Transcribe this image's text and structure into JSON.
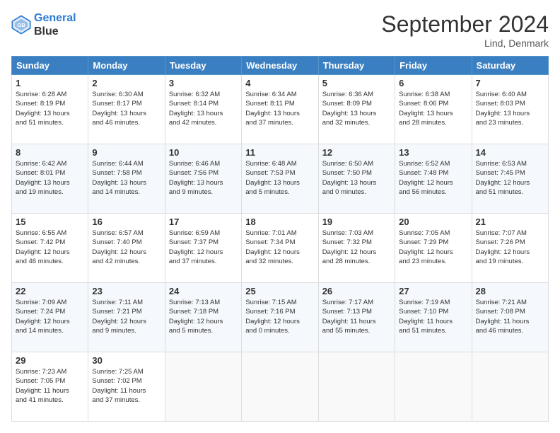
{
  "header": {
    "logo_line1": "General",
    "logo_line2": "Blue",
    "month_title": "September 2024",
    "location": "Lind, Denmark"
  },
  "days_of_week": [
    "Sunday",
    "Monday",
    "Tuesday",
    "Wednesday",
    "Thursday",
    "Friday",
    "Saturday"
  ],
  "weeks": [
    [
      {
        "day": "1",
        "info": "Sunrise: 6:28 AM\nSunset: 8:19 PM\nDaylight: 13 hours\nand 51 minutes."
      },
      {
        "day": "2",
        "info": "Sunrise: 6:30 AM\nSunset: 8:17 PM\nDaylight: 13 hours\nand 46 minutes."
      },
      {
        "day": "3",
        "info": "Sunrise: 6:32 AM\nSunset: 8:14 PM\nDaylight: 13 hours\nand 42 minutes."
      },
      {
        "day": "4",
        "info": "Sunrise: 6:34 AM\nSunset: 8:11 PM\nDaylight: 13 hours\nand 37 minutes."
      },
      {
        "day": "5",
        "info": "Sunrise: 6:36 AM\nSunset: 8:09 PM\nDaylight: 13 hours\nand 32 minutes."
      },
      {
        "day": "6",
        "info": "Sunrise: 6:38 AM\nSunset: 8:06 PM\nDaylight: 13 hours\nand 28 minutes."
      },
      {
        "day": "7",
        "info": "Sunrise: 6:40 AM\nSunset: 8:03 PM\nDaylight: 13 hours\nand 23 minutes."
      }
    ],
    [
      {
        "day": "8",
        "info": "Sunrise: 6:42 AM\nSunset: 8:01 PM\nDaylight: 13 hours\nand 19 minutes."
      },
      {
        "day": "9",
        "info": "Sunrise: 6:44 AM\nSunset: 7:58 PM\nDaylight: 13 hours\nand 14 minutes."
      },
      {
        "day": "10",
        "info": "Sunrise: 6:46 AM\nSunset: 7:56 PM\nDaylight: 13 hours\nand 9 minutes."
      },
      {
        "day": "11",
        "info": "Sunrise: 6:48 AM\nSunset: 7:53 PM\nDaylight: 13 hours\nand 5 minutes."
      },
      {
        "day": "12",
        "info": "Sunrise: 6:50 AM\nSunset: 7:50 PM\nDaylight: 13 hours\nand 0 minutes."
      },
      {
        "day": "13",
        "info": "Sunrise: 6:52 AM\nSunset: 7:48 PM\nDaylight: 12 hours\nand 56 minutes."
      },
      {
        "day": "14",
        "info": "Sunrise: 6:53 AM\nSunset: 7:45 PM\nDaylight: 12 hours\nand 51 minutes."
      }
    ],
    [
      {
        "day": "15",
        "info": "Sunrise: 6:55 AM\nSunset: 7:42 PM\nDaylight: 12 hours\nand 46 minutes."
      },
      {
        "day": "16",
        "info": "Sunrise: 6:57 AM\nSunset: 7:40 PM\nDaylight: 12 hours\nand 42 minutes."
      },
      {
        "day": "17",
        "info": "Sunrise: 6:59 AM\nSunset: 7:37 PM\nDaylight: 12 hours\nand 37 minutes."
      },
      {
        "day": "18",
        "info": "Sunrise: 7:01 AM\nSunset: 7:34 PM\nDaylight: 12 hours\nand 32 minutes."
      },
      {
        "day": "19",
        "info": "Sunrise: 7:03 AM\nSunset: 7:32 PM\nDaylight: 12 hours\nand 28 minutes."
      },
      {
        "day": "20",
        "info": "Sunrise: 7:05 AM\nSunset: 7:29 PM\nDaylight: 12 hours\nand 23 minutes."
      },
      {
        "day": "21",
        "info": "Sunrise: 7:07 AM\nSunset: 7:26 PM\nDaylight: 12 hours\nand 19 minutes."
      }
    ],
    [
      {
        "day": "22",
        "info": "Sunrise: 7:09 AM\nSunset: 7:24 PM\nDaylight: 12 hours\nand 14 minutes."
      },
      {
        "day": "23",
        "info": "Sunrise: 7:11 AM\nSunset: 7:21 PM\nDaylight: 12 hours\nand 9 minutes."
      },
      {
        "day": "24",
        "info": "Sunrise: 7:13 AM\nSunset: 7:18 PM\nDaylight: 12 hours\nand 5 minutes."
      },
      {
        "day": "25",
        "info": "Sunrise: 7:15 AM\nSunset: 7:16 PM\nDaylight: 12 hours\nand 0 minutes."
      },
      {
        "day": "26",
        "info": "Sunrise: 7:17 AM\nSunset: 7:13 PM\nDaylight: 11 hours\nand 55 minutes."
      },
      {
        "day": "27",
        "info": "Sunrise: 7:19 AM\nSunset: 7:10 PM\nDaylight: 11 hours\nand 51 minutes."
      },
      {
        "day": "28",
        "info": "Sunrise: 7:21 AM\nSunset: 7:08 PM\nDaylight: 11 hours\nand 46 minutes."
      }
    ],
    [
      {
        "day": "29",
        "info": "Sunrise: 7:23 AM\nSunset: 7:05 PM\nDaylight: 11 hours\nand 41 minutes."
      },
      {
        "day": "30",
        "info": "Sunrise: 7:25 AM\nSunset: 7:02 PM\nDaylight: 11 hours\nand 37 minutes."
      },
      {
        "day": "",
        "info": ""
      },
      {
        "day": "",
        "info": ""
      },
      {
        "day": "",
        "info": ""
      },
      {
        "day": "",
        "info": ""
      },
      {
        "day": "",
        "info": ""
      }
    ]
  ]
}
